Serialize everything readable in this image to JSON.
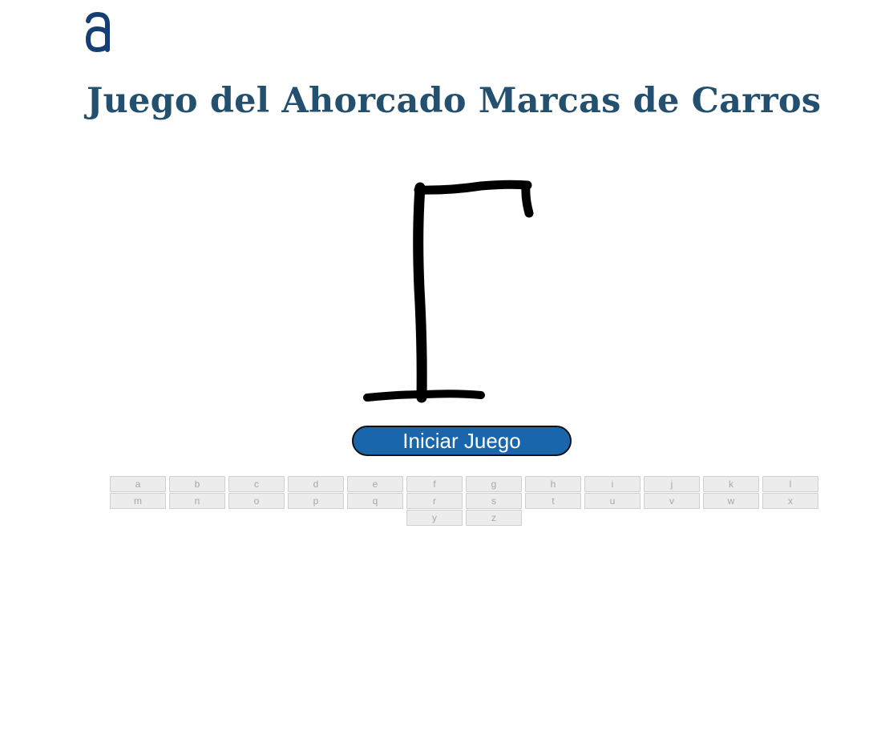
{
  "logo_icon": "a-letter-logo-icon",
  "colors": {
    "logo": "#153e75",
    "title": "#22506e",
    "start_button_bg": "#1a66ad",
    "key_bg": "#ececec",
    "key_text": "#a8a8a8"
  },
  "title": "Juego del Ahorcado Marcas de Carros",
  "start_button_label": "Iniciar Juego",
  "keyboard": {
    "keys": [
      "a",
      "b",
      "c",
      "d",
      "e",
      "f",
      "g",
      "h",
      "i",
      "j",
      "k",
      "l",
      "m",
      "n",
      "o",
      "p",
      "q",
      "r",
      "s",
      "t",
      "u",
      "v",
      "w",
      "x",
      "y",
      "z"
    ]
  }
}
